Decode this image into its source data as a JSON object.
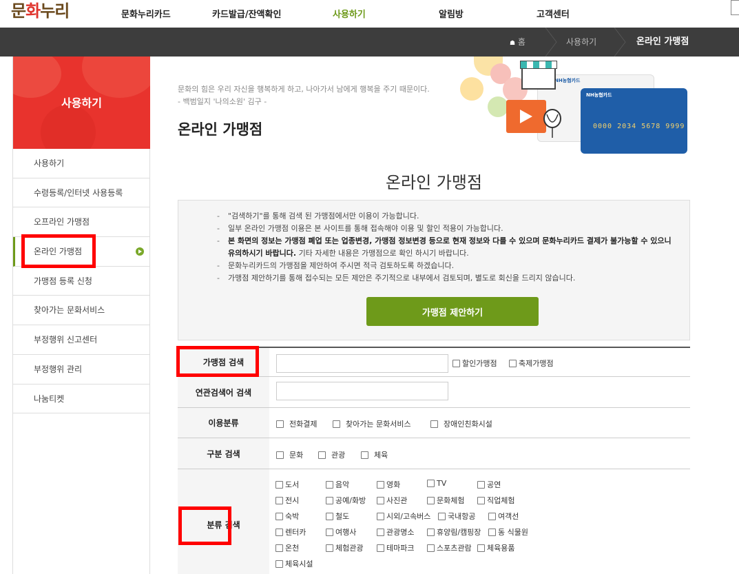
{
  "header": {
    "logo": "문화누리",
    "nav": [
      "문화누리카드",
      "카드발급/잔액확인",
      "사용하기",
      "알림방",
      "고객센터"
    ]
  },
  "breadcrumb": {
    "home": "홈",
    "level1": "사용하기",
    "current": "온라인 가맹점"
  },
  "sidebar": {
    "title": "사용하기",
    "items": [
      "사용하기",
      "수령등록/인터넷 사용등록",
      "오프라인 가맹점",
      "온라인 가맹점",
      "가맹점 등록 신청",
      "찾아가는 문화서비스",
      "부정행위 신고센터",
      "부정행위 관리",
      "나눔티켓"
    ]
  },
  "intro": {
    "quote_line1": "문화의 힘은 우리 자신을 행복하게 하고, 나아가서 남에게 행복을 주기 때문이다.",
    "quote_line2": "- 백범일지 '나의소원' 김구 -",
    "page_title": "온라인 가맹점"
  },
  "cards": {
    "card_brand": "NH농협카드",
    "card2_brand": "NH농협카드",
    "card2_number": "0000 2034 5678 9999"
  },
  "section_title": "온라인 가맹점",
  "notice": {
    "items": [
      "\"검색하기\"를 통해 검색 된 가맹점에서만 이용이 가능합니다.",
      "일부 온라인 가맹점 이용은 본 사이트를 통해 접속해야 이용 및 할인 적용이 가능합니다.",
      "",
      "문화누리카드의 가맹점을 제안하여 주시면 적극 검토하도록 하겠습니다.",
      "가맹점 제안하기를 통해 접수되는 모든 제안은 주기적으로 내부에서 검토되며, 별도로 회신을 드리지 않습니다."
    ],
    "bold_part": "본 화면의 정보는 가맹점 폐업 또는 업종변경, 가맹점 정보변경 등으로 현재 정보와 다를 수 있으며 문화누리카드 결제가 불가능할 수 있으니 유의하시기 바랍니다.",
    "normal_part": " 기타 자세한 내용은 가맹점으로 확인 하시기 바랍니다.",
    "button": "가맹점 제안하기"
  },
  "search": {
    "row1_label": "가맹점 검색",
    "row1_checks": [
      "할인가맹점",
      "축제가맹점"
    ],
    "row2_label": "연관검색어 검색",
    "row3_label": "이용분류",
    "row3_checks": [
      "전화결제",
      "찾아가는 문화서비스",
      "장애인친화시설"
    ],
    "row4_label": "구분 검색",
    "row4_checks": [
      "문화",
      "관광",
      "체육"
    ],
    "row5_label": "분류 검색",
    "row5_checks": [
      [
        "도서",
        "음악",
        "영화",
        "TV",
        "공연"
      ],
      [
        "전시",
        "공예/화방",
        "사진관",
        "문화체험",
        "직업체험"
      ],
      [
        "숙박",
        "철도",
        "시외/고속버스",
        "국내항공",
        "여객선"
      ],
      [
        "렌터카",
        "여행사",
        "관광명소",
        "휴양림/캠핑장",
        "동 식물원"
      ],
      [
        "온천",
        "체험관광",
        "테마파크",
        "스포츠관람",
        "체육용품"
      ],
      [
        "체육시설"
      ]
    ]
  },
  "colors": {
    "accent_green": "#6e9a1a",
    "sidebar_red": "#e8332d",
    "crumb_bar": "#3d3d3d",
    "highlight_frame": "#ff0000"
  }
}
